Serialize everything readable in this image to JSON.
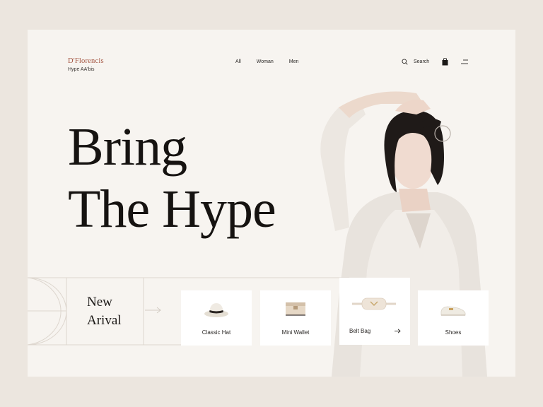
{
  "brand": {
    "name": "D'Florencis",
    "tagline": "Hype AA'bis"
  },
  "nav": {
    "items": [
      {
        "label": "All"
      },
      {
        "label": "Woman"
      },
      {
        "label": "Men"
      }
    ]
  },
  "toolbar": {
    "search_label": "Search",
    "icons": [
      "search-icon",
      "shopping-bag-icon",
      "menu-icon"
    ]
  },
  "hero": {
    "line1": "Bring",
    "line2": "The Hype"
  },
  "arrival": {
    "line1": "New",
    "line2": "Arival"
  },
  "products": [
    {
      "label": "Classic Hat",
      "icon": "hat"
    },
    {
      "label": "Mini Wallet",
      "icon": "wallet"
    },
    {
      "label": "Belt Bag",
      "icon": "belt-bag",
      "active": true
    },
    {
      "label": "Shoes",
      "icon": "shoe"
    }
  ],
  "colors": {
    "brand": "#a3533f",
    "background": "#ece6df",
    "card": "#f7f4f0",
    "text": "#161311"
  }
}
